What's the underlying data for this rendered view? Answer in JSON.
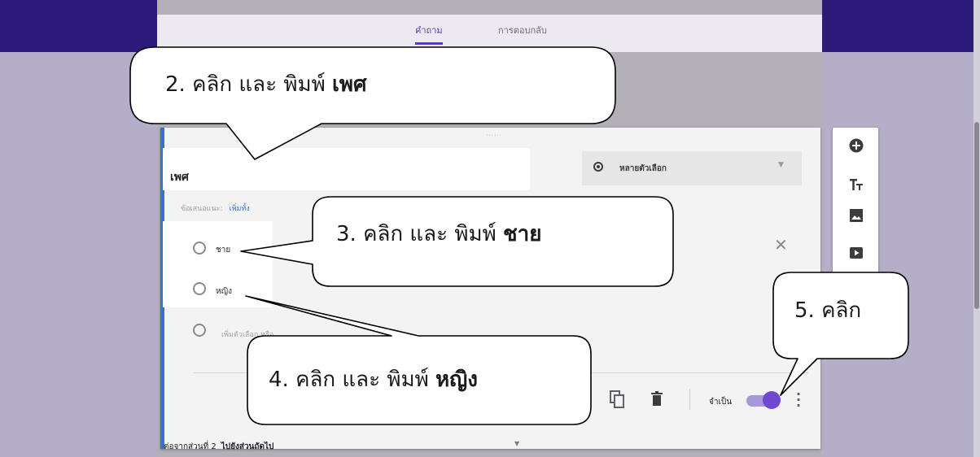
{
  "tabs": {
    "questions": "คำถาม",
    "responses": "การตอบกลับ"
  },
  "question": {
    "title": "เพศ",
    "hint_prefix": "ข้อเสนอแนะ:",
    "hint_link": "เพิ่มทั้ง",
    "type_label": "หลายตัวเลือก",
    "options": [
      "ชาย",
      "หญิง"
    ],
    "add_option": "เพิ่มตัวเลือก หรือ",
    "required_label": "จำเป็น",
    "required": true
  },
  "footer": {
    "continue_prefix": "ต่อจากส่วนที่ 2",
    "continue_value": "ไปยังส่วนถัดไป"
  },
  "toolbar_icons": [
    "add-circle-icon",
    "text-title-icon",
    "image-icon",
    "video-icon"
  ],
  "callouts": {
    "c2_text": "2. คลิก และ พิมพ์ ",
    "c2_bold": "เพศ",
    "c3_text": "3. คลิก และ พิมพ์ ",
    "c3_bold": "ชาย",
    "c4_text": "4. คลิก และ พิมพ์ ",
    "c4_bold": "หญิง",
    "c5_text": "5. คลิก"
  },
  "colors": {
    "header": "#2c1a7a",
    "accent": "#6f48d0",
    "link": "#3b78e7",
    "card_border": "#3d6fd1"
  }
}
